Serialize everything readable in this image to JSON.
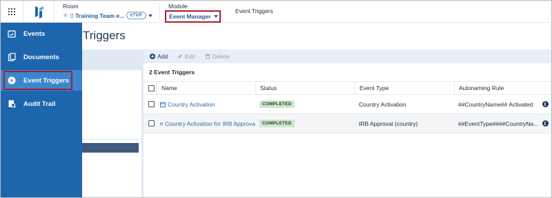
{
  "topbar": {
    "room_caption": "Room",
    "room_name": "Training Team e...",
    "room_tag": "eTMF",
    "module_caption": "Module",
    "module_name": "Event Manager",
    "breadcrumb": "Event Triggers"
  },
  "sidebar": {
    "items": [
      {
        "label": "Events",
        "icon": "calendar-check-icon"
      },
      {
        "label": "Documents",
        "icon": "documents-icon"
      },
      {
        "label": "Event Triggers",
        "icon": "play-circle-icon",
        "active": true
      },
      {
        "label": "Audit Trail",
        "icon": "audit-trail-icon"
      }
    ]
  },
  "page": {
    "title": "Triggers"
  },
  "toolbar": {
    "add_label": "Add",
    "edit_label": "Edit",
    "delete_label": "Delete"
  },
  "grid": {
    "count_label": "2 Event Triggers",
    "columns": [
      "Name",
      "Status",
      "Event Type",
      "Autonaming Rule"
    ],
    "rows": [
      {
        "name": "Country Activation",
        "status": "COMPLETED",
        "event_type": "Country Activation",
        "autonaming_rule": "##CountryName## Activated"
      },
      {
        "name": "Country Activation for IRB Approva",
        "status": "COMPLETED",
        "event_type": "IRB Approval (country)",
        "autonaming_rule": "##EventType####CountryNa..."
      }
    ]
  },
  "colors": {
    "sidebar_bg": "#1d66ae",
    "sidebar_active": "#3a86cf",
    "highlight_border": "#a71d2a",
    "link": "#2a6cb0",
    "status_badge_bg": "#cfe7cf"
  }
}
